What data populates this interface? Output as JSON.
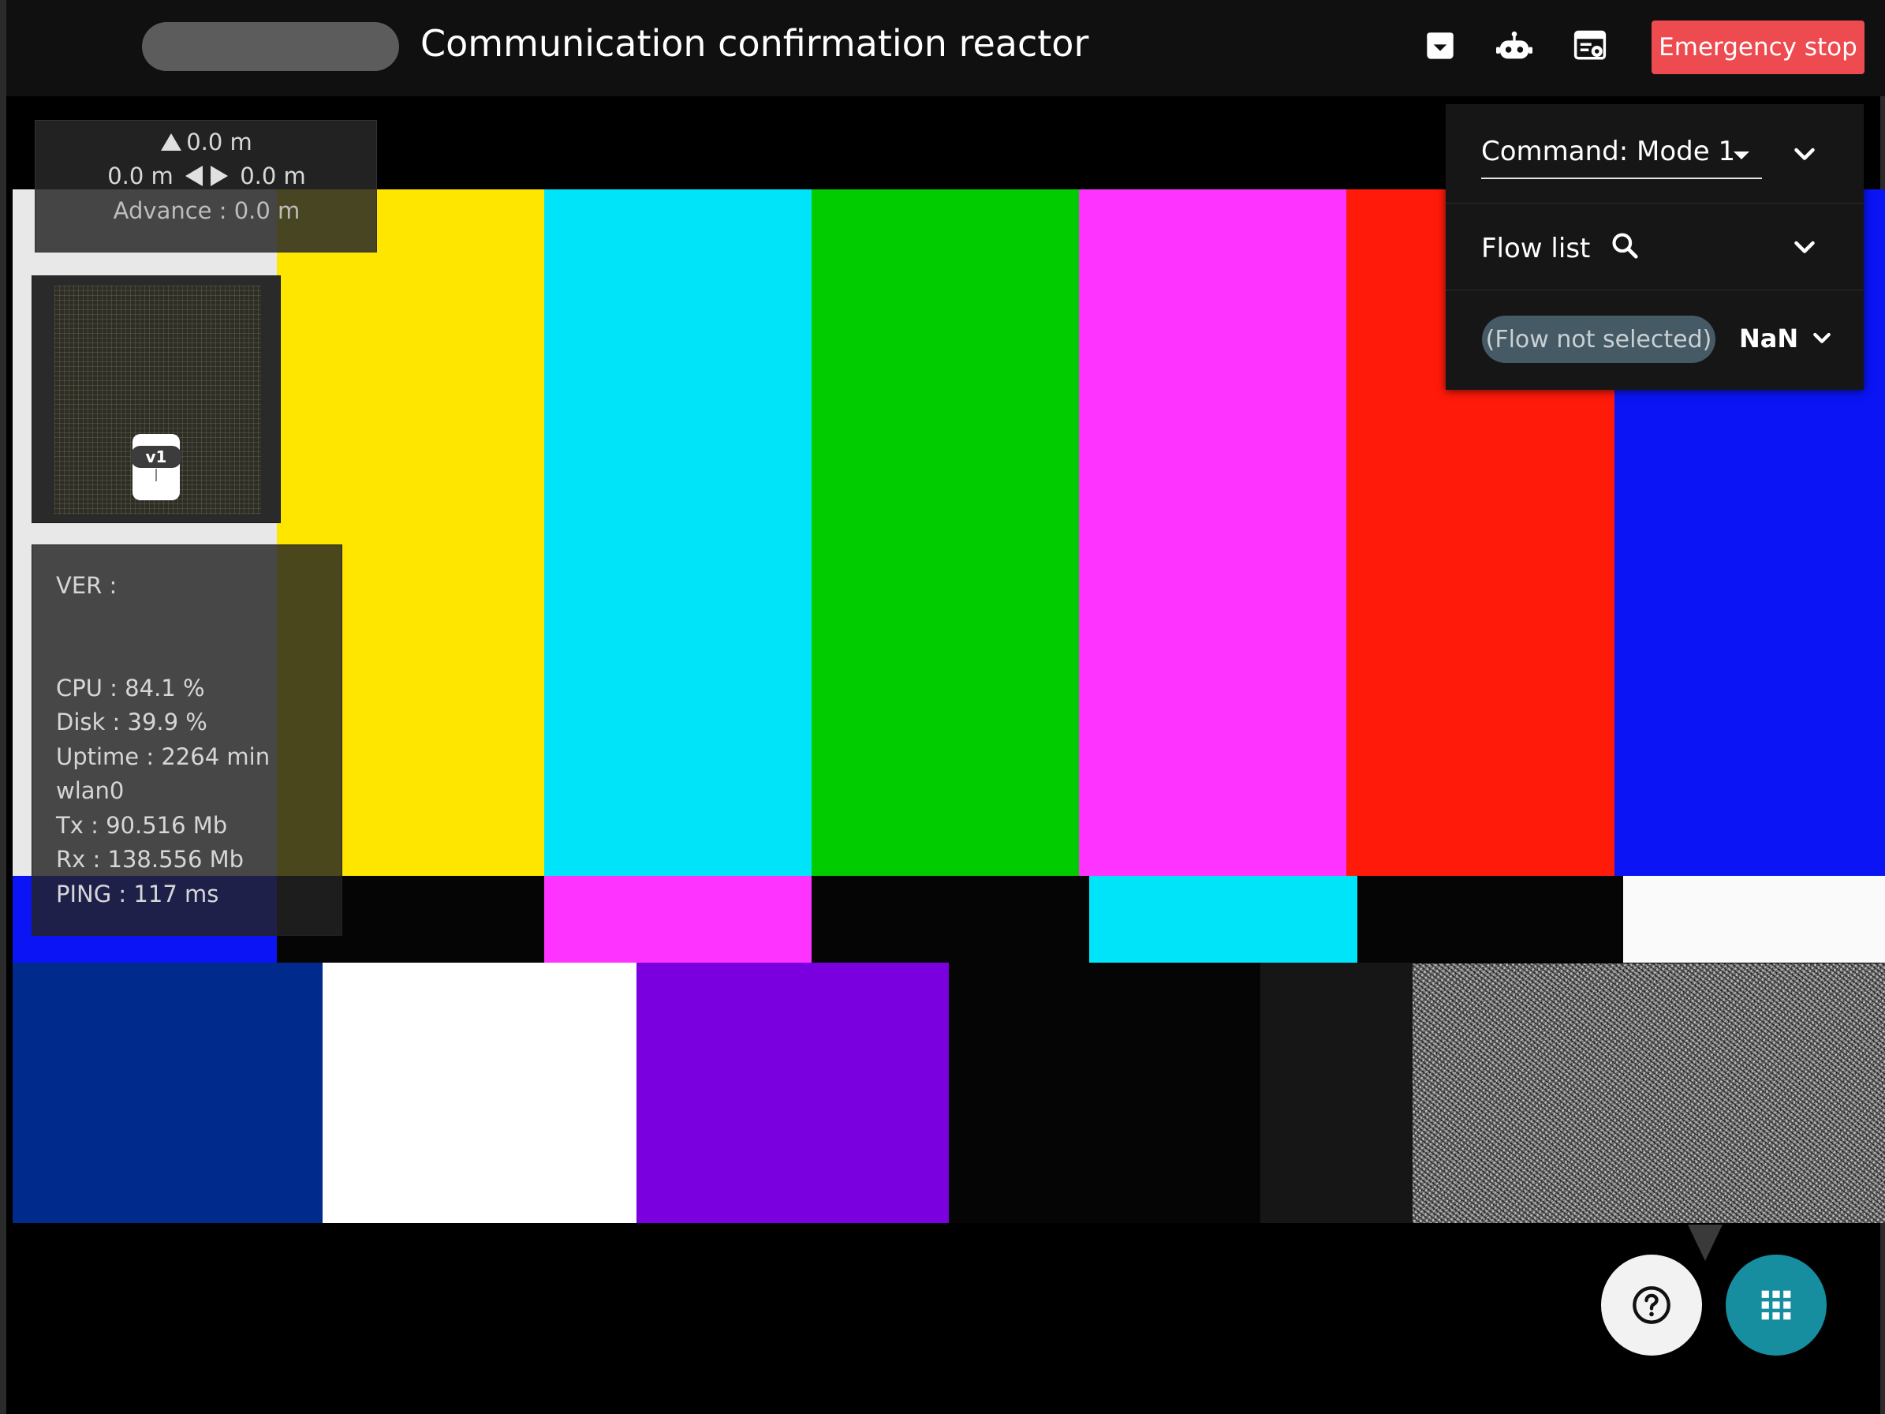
{
  "header": {
    "title": "Communication confirmation reactor",
    "icons": [
      "archive-icon",
      "robot-icon",
      "browser-settings-icon"
    ],
    "emergency_label": "Emergency stop"
  },
  "colors": {
    "emergency": "#ee4b50",
    "fab_accent": "#168ea0",
    "chip": "#455a64"
  },
  "position": {
    "forward": "0.0 m",
    "left": "0.0 m",
    "right": "0.0 m",
    "advance": "Advance : 0.0 m"
  },
  "map": {
    "robot_label": "v1"
  },
  "status": {
    "ver": "VER :",
    "cpu": "CPU : 84.1 %",
    "disk": "Disk : 39.9 %",
    "uptime": "Uptime : 2264 min",
    "iface": "wlan0",
    "tx": "Tx : 90.516 Mb",
    "rx": "Rx : 138.556 Mb",
    "ping": "PING : 117 ms"
  },
  "controls": {
    "command_value": "Command: Mode 1",
    "flow_list_label": "Flow list",
    "flow_chip": "(Flow not selected)",
    "flow_value": "NaN"
  },
  "fabs": {
    "help_icon": "help-circle-icon",
    "apps_icon": "grid-icon"
  }
}
